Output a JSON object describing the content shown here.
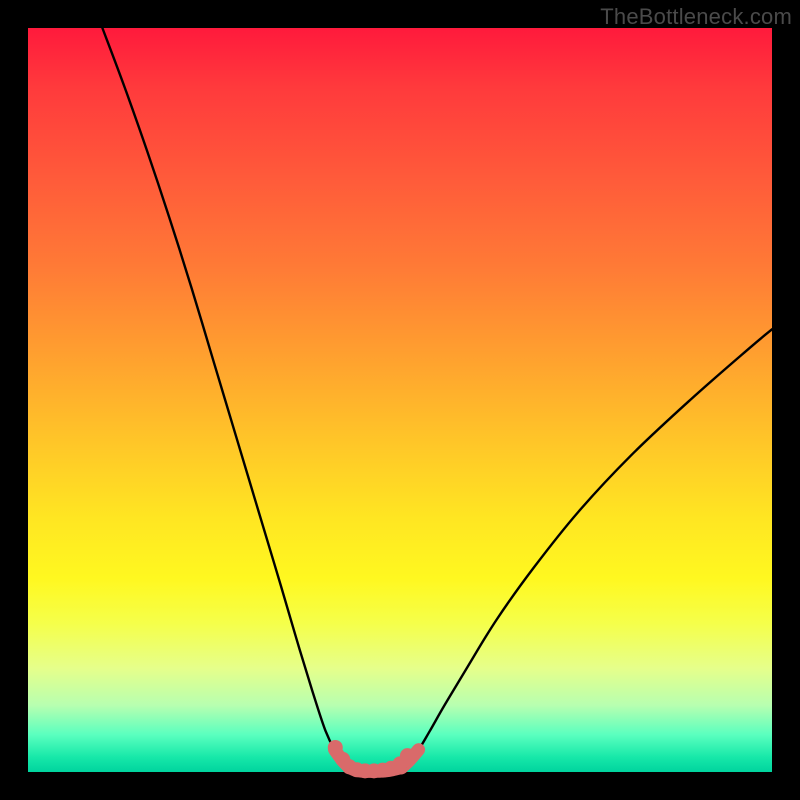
{
  "watermark": "TheBottleneck.com",
  "colors": {
    "background": "#000000",
    "curve": "#000000",
    "marker": "#d96a6a",
    "gradient_stops": [
      "#ff1a3c",
      "#ff7a36",
      "#ffe622",
      "#b8ffb0",
      "#00d49e"
    ]
  },
  "chart_data": {
    "type": "line",
    "title": "",
    "xlabel": "",
    "ylabel": "",
    "xlim": [
      0,
      100
    ],
    "ylim": [
      0,
      100
    ],
    "series": [
      {
        "name": "left-curve",
        "x": [
          10,
          13,
          16,
          19,
          22,
          25,
          28,
          31,
          34,
          36.5,
          38.5,
          40,
          41.2,
          42.3,
          43.2
        ],
        "y": [
          100,
          92,
          83.5,
          74.5,
          65,
          55,
          45,
          35,
          25,
          16.5,
          10,
          5.5,
          3,
          1.5,
          0.6
        ]
      },
      {
        "name": "right-curve",
        "x": [
          50.2,
          51.2,
          52.5,
          54,
          56,
          59,
          63,
          68,
          74,
          81,
          89,
          97,
          100
        ],
        "y": [
          0.6,
          1.5,
          3,
          5.5,
          9,
          14,
          20.5,
          27.5,
          35,
          42.5,
          50,
          57,
          59.5
        ]
      },
      {
        "name": "valley-floor",
        "x": [
          43.2,
          44,
          45,
          46,
          47,
          48,
          49,
          50.2
        ],
        "y": [
          0.6,
          0.25,
          0.1,
          0.08,
          0.1,
          0.15,
          0.3,
          0.6
        ]
      }
    ],
    "markers": {
      "name": "valley-markers",
      "x": [
        41.3,
        42.3,
        43.2,
        44.2,
        45.3,
        46.5,
        47.7,
        48.8,
        50.0,
        51.0
      ],
      "y": [
        3.3,
        1.7,
        0.7,
        0.3,
        0.15,
        0.15,
        0.25,
        0.5,
        1.1,
        2.2
      ]
    }
  }
}
